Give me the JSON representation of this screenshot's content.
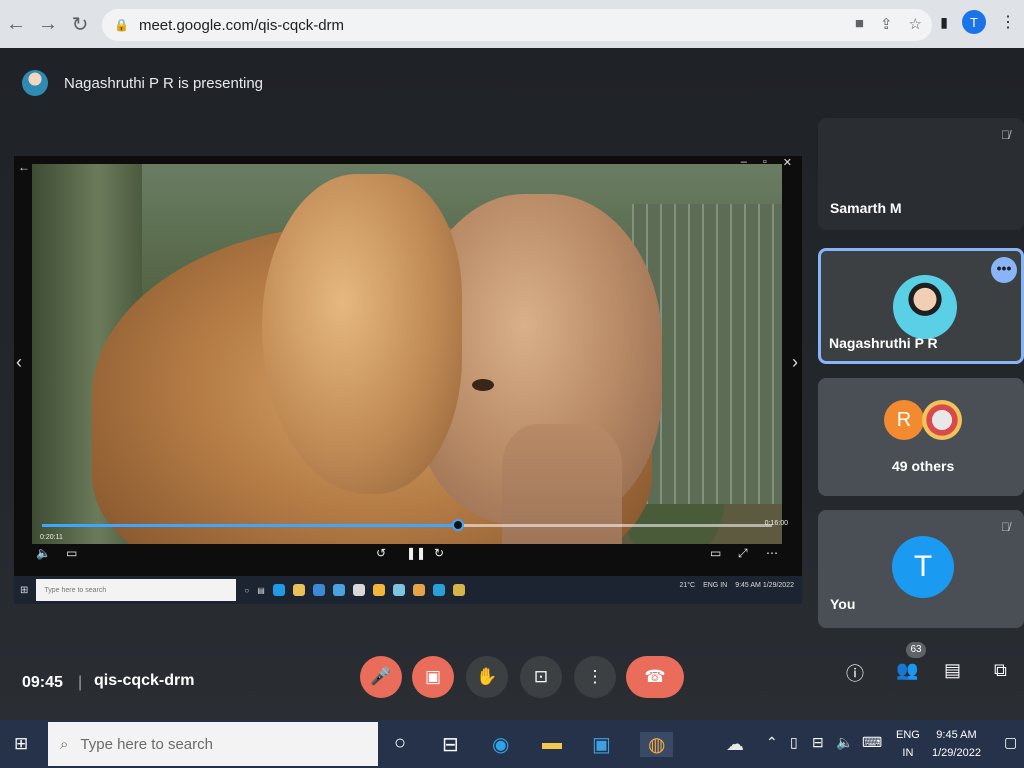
{
  "browser": {
    "url": "meet.google.com/qis-cqck-drm",
    "profile_initial": "T",
    "icons": [
      "back-icon",
      "forward-icon",
      "reload-icon",
      "camera-icon",
      "share-icon",
      "star-icon",
      "sidepanel-icon",
      "menu-icon"
    ]
  },
  "presenter": {
    "text": "Nagashruthi P R is presenting"
  },
  "video": {
    "time_current": "0:20:11",
    "time_total": "0:16:00",
    "progress_fraction": 0.57
  },
  "inner_taskbar": {
    "search_placeholder": "Type here to search",
    "temperature": "21°C",
    "lang_top": "ENG",
    "lang_bottom": "IN",
    "time": "9:45 AM",
    "date": "1/29/2022"
  },
  "participants": [
    {
      "name": "Samarth M"
    },
    {
      "name": "Nagashruthi P R"
    },
    {
      "name": "49 others",
      "initial": "R"
    },
    {
      "name": "You",
      "initial": "T"
    }
  ],
  "meeting": {
    "time": "09:45",
    "separator": "|",
    "code": "qis-cqck-drm",
    "people_count": "63"
  },
  "taskbar": {
    "search_placeholder": "Type here to search",
    "lang_top": "ENG",
    "lang_bottom": "IN",
    "time": "9:45 AM",
    "date": "1/29/2022"
  },
  "colors": {
    "accent_blue": "#8ab4f8",
    "end_call_red": "#ea6c5a",
    "progress_blue": "#3ea6ff"
  }
}
